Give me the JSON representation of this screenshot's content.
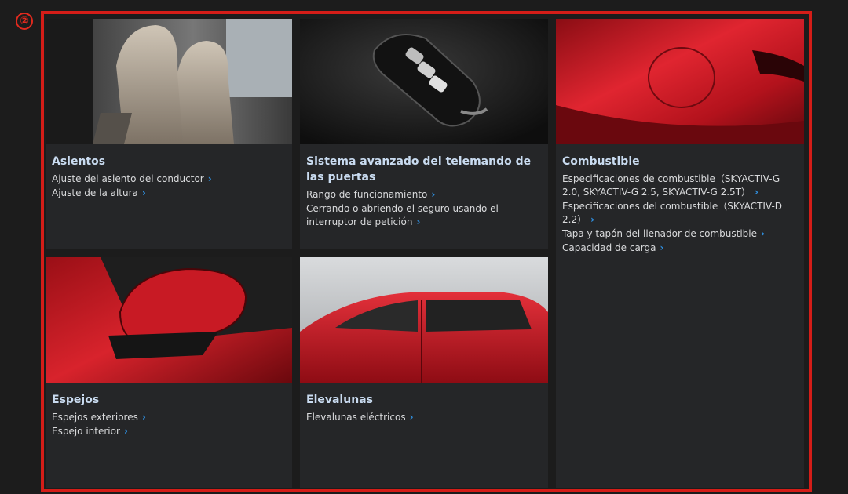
{
  "badge": "②",
  "cards": [
    {
      "title": "Asientos",
      "image": "car-seats",
      "links": [
        "Ajuste del asiento del conductor",
        "Ajuste de la altura"
      ]
    },
    {
      "title": "Sistema avanzado del telemando de las puertas",
      "image": "smart-key",
      "links": [
        "Rango de funcionamiento",
        "Cerrando o abriendo el seguro usando el interruptor de petición"
      ]
    },
    {
      "title": "Combustible",
      "image": "fuel-door",
      "links": [
        "Especificaciones de combustible（SKYACTIV-G 2.0, SKYACTIV-G 2.5, SKYACTIV-G 2.5T）",
        "Especificaciones del combustible（SKYACTIV-D 2.2）",
        "Tapa y tapón del llenador de combustible",
        "Capacidad de carga"
      ]
    },
    {
      "title": "Espejos",
      "image": "side-mirror",
      "links": [
        "Espejos exteriores",
        "Espejo interior"
      ]
    },
    {
      "title": "Elevalunas",
      "image": "car-windows",
      "links": [
        "Elevalunas eléctricos"
      ]
    }
  ],
  "colors": {
    "frame": "#d41d18",
    "card_bg": "#252628",
    "title": "#c9dbf0",
    "link": "#d9dadc",
    "chevron": "#2f8fe0"
  }
}
